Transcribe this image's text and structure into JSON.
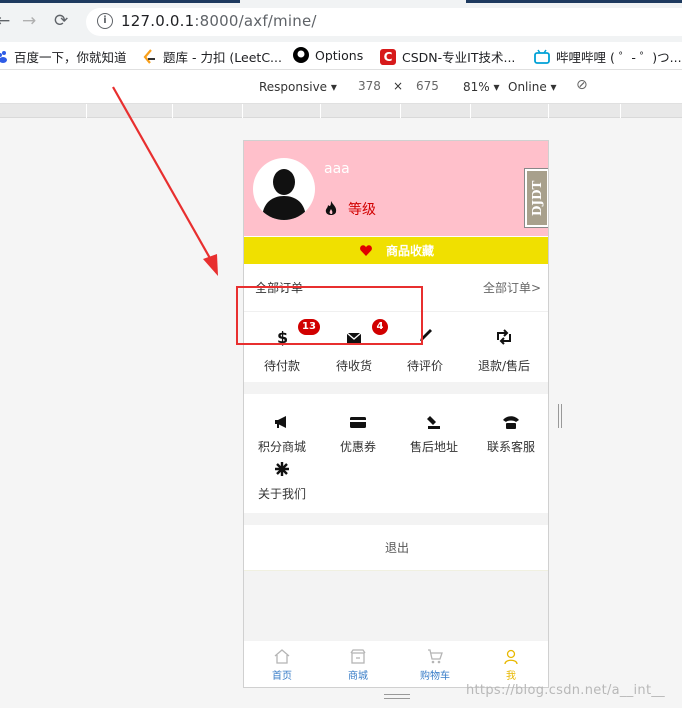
{
  "browser": {
    "url_host": "127.0.0.1",
    "url_rest": ":8000/axf/mine/",
    "bookmarks": [
      {
        "label": "百度一下，你就知道",
        "icon": "baidu-icon",
        "color": "#2e5ce6"
      },
      {
        "label": "题库 - 力扣 (LeetC...",
        "icon": "leetcode-icon",
        "color": "#f89f1b"
      },
      {
        "label": "Options",
        "icon": "github-icon",
        "color": "#000000"
      },
      {
        "label": "CSDN-专业IT技术...",
        "icon": "csdn-icon",
        "color": "#d71a1b"
      },
      {
        "label": "哔哩哔哩 ( ゜- ゜)つ...",
        "icon": "bilibili-icon",
        "color": "#00a1d6"
      }
    ]
  },
  "devtools": {
    "device": "Responsive",
    "width": "378",
    "times": "×",
    "height": "675",
    "zoom": "81%",
    "network": "Online"
  },
  "app": {
    "profile": {
      "username": "aaa",
      "level": "等级",
      "background": "#ffc0cb"
    },
    "favorites": "商品收藏",
    "orders": {
      "title": "全部订单",
      "all_link": "全部订单>",
      "items": [
        {
          "label": "待付款",
          "icon": "dollar-icon",
          "badge": "13"
        },
        {
          "label": "待收货",
          "icon": "envelope-icon",
          "badge": "4"
        },
        {
          "label": "待评价",
          "icon": "pencil-icon"
        },
        {
          "label": "退款/售后",
          "icon": "retweet-icon"
        }
      ]
    },
    "services": [
      {
        "label": "积分商城",
        "icon": "megaphone-icon"
      },
      {
        "label": "优惠券",
        "icon": "credit-card-icon"
      },
      {
        "label": "售后地址",
        "icon": "location-icon"
      },
      {
        "label": "联系客服",
        "icon": "phone-icon"
      },
      {
        "label": "关于我们",
        "icon": "asterisk-icon"
      }
    ],
    "logout": "退出",
    "tabs": [
      {
        "label": "首页",
        "icon": "home-icon"
      },
      {
        "label": "商城",
        "icon": "shop-icon"
      },
      {
        "label": "购物车",
        "icon": "cart-icon"
      },
      {
        "label": "我",
        "icon": "user-icon",
        "active": true
      }
    ]
  },
  "watermark": "https://blog.csdn.net/a__int__",
  "colors": {
    "accent_yellow": "#f0e000",
    "badge_red": "#d10000",
    "annotation_red": "#e82f2f",
    "tab_blue": "#3a7ec8",
    "tab_active": "#e8b800"
  }
}
